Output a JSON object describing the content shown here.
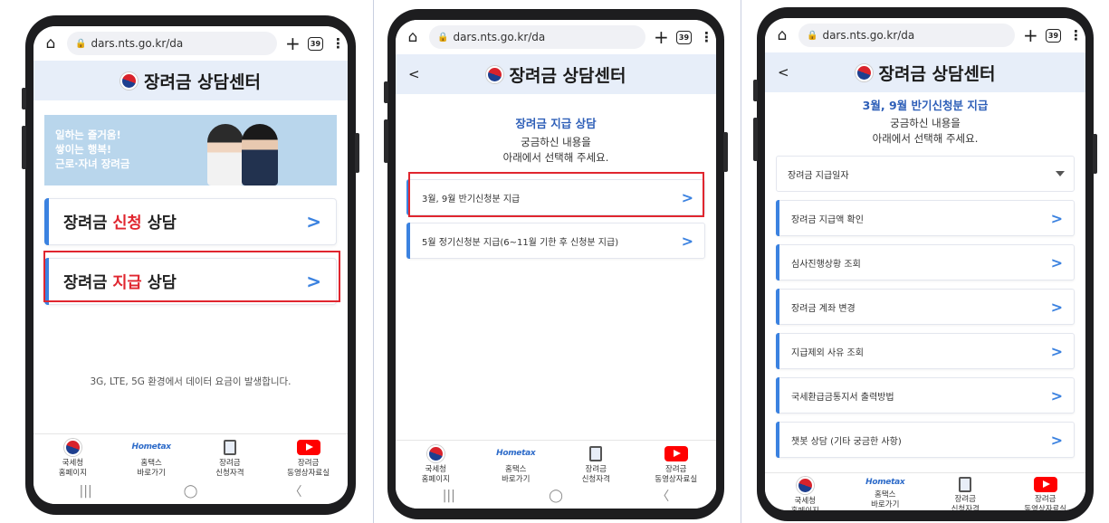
{
  "browser": {
    "url": "dars.nts.go.kr/da",
    "tab_count": "39"
  },
  "app": {
    "title": "장려금 상담센터",
    "back_label": "<"
  },
  "screen1": {
    "banner_lines": [
      "일하는 즐거움!",
      "쌓이는 행복!",
      "근로·자녀 장려금"
    ],
    "menu": [
      {
        "pre": "장려금 ",
        "em": "신청",
        "post": " 상담"
      },
      {
        "pre": "장려금 ",
        "em": "지급",
        "post": " 상담"
      }
    ],
    "notice": "3G, LTE, 5G 환경에서 데이터 요금이 발생합니다."
  },
  "screen2": {
    "section_title": "장려금 지급 상담",
    "subtitle_1": "궁금하신 내용을",
    "subtitle_2": "아래에서 선택해 주세요.",
    "items": [
      "3월, 9월 반기신청분 지급",
      "5월 정기신청분 지급(6~11월 기한 후 신청분 지급)"
    ]
  },
  "screen3": {
    "section_title": "3월, 9월 반기신청분 지급",
    "subtitle_1": "궁금하신 내용을",
    "subtitle_2": "아래에서 선택해 주세요.",
    "dropdown_label": "장려금 지급일자",
    "items": [
      "장려금 지급액 확인",
      "심사진행상황 조회",
      "장려금 계좌 변경",
      "지급제외 사유 조회",
      "국세환급금통지서 출력방법",
      "챗봇 상담 (기타 궁금한 사항)"
    ]
  },
  "bottom_nav": [
    {
      "line1": "국세청",
      "line2": "홈페이지",
      "icon": "nts-logo-icon"
    },
    {
      "line1": "홈택스",
      "line2": "바로가기",
      "icon": "hometax-icon",
      "logo_text": "Hometax"
    },
    {
      "line1": "장려금",
      "line2": "신청자격",
      "icon": "document-icon"
    },
    {
      "line1": "장려금",
      "line2": "동영상자료실",
      "icon": "youtube-icon"
    }
  ],
  "system_nav": {
    "recents": "|||",
    "home": "◯",
    "back": "〈"
  },
  "colors": {
    "accent_blue": "#3b82e0",
    "highlight_red": "#e0262f",
    "header_bg": "#e7eef9",
    "title_blue": "#2e5fb8"
  }
}
